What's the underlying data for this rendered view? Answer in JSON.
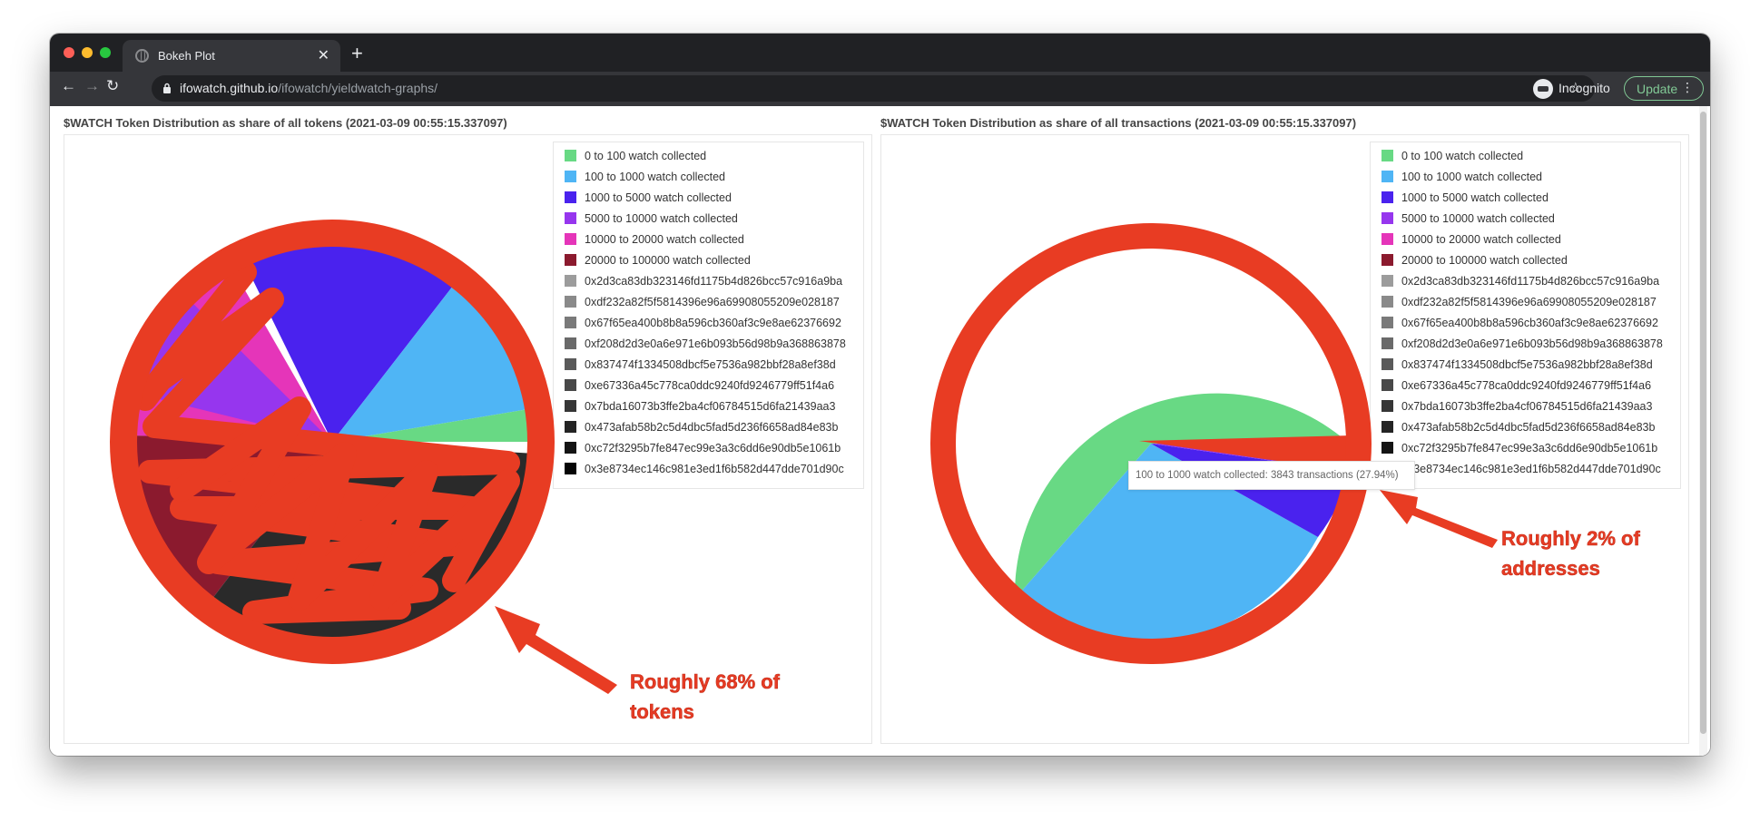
{
  "browser": {
    "tab_title": "Bokeh Plot",
    "url_host": "ifowatch.github.io",
    "url_path": "/ifowatch/yieldwatch-graphs/",
    "profile_label": "Incognito",
    "update_label": "Update"
  },
  "icons": [
    "close-icon",
    "plus-icon",
    "back-icon",
    "forward-icon",
    "reload-icon",
    "lock-icon",
    "star-icon",
    "incognito-icon",
    "more-icon"
  ],
  "plots": [
    {
      "title": "$WATCH Token Distribution as share of all tokens (2021-03-09 00:55:15.337097)"
    },
    {
      "title": "$WATCH Token Distribution as share of all transactions (2021-03-09 00:55:15.337097)"
    }
  ],
  "legend": [
    {
      "label": "0 to 100 watch collected",
      "color": "#68d984"
    },
    {
      "label": "100 to 1000 watch collected",
      "color": "#4fb5f5"
    },
    {
      "label": "1000 to 5000 watch collected",
      "color": "#4a22ee"
    },
    {
      "label": "5000 to 10000 watch collected",
      "color": "#9636ee"
    },
    {
      "label": "10000 to 20000 watch collected",
      "color": "#e535b9"
    },
    {
      "label": "20000 to 100000 watch collected",
      "color": "#8b1a2e"
    },
    {
      "label": "0x2d3ca83db323146fd1175b4d826bcc57c916a9ba",
      "color": "#9c9c9c"
    },
    {
      "label": "0xdf232a82f5f5814396e96a69908055209e028187",
      "color": "#8a8a8a"
    },
    {
      "label": "0x67f65ea400b8b8a596cb360af3c9e8ae62376692",
      "color": "#7a7a7a"
    },
    {
      "label": "0xf208d2d3e0a6e971e6b093b56d98b9a368863878",
      "color": "#6a6a6a"
    },
    {
      "label": "0x837474f1334508dbcf5e7536a982bbf28a8ef38d",
      "color": "#5a5a5a"
    },
    {
      "label": "0xe67336a45c778ca0ddc9240fd9246779ff51f4a6",
      "color": "#484848"
    },
    {
      "label": "0x7bda16073b3ffe2ba4cf06784515d6fa21439aa3",
      "color": "#363636"
    },
    {
      "label": "0x473afab58b2c5d4dbc5fad5d236f6658ad84e83b",
      "color": "#242424"
    },
    {
      "label": "0xc72f3295b7fe847ec99e3a3c6dd6e90db5e1061b",
      "color": "#141414"
    },
    {
      "label": "0x3e8734ec146c981e3ed1f6b582d447dde701d90c",
      "color": "#050505"
    }
  ],
  "tooltip": {
    "text": "100 to 1000 watch collected: 3843 transactions (27.94%)"
  },
  "annotations": {
    "left_line1": "Roughly 68% of",
    "left_line2": "tokens",
    "right_line1": "Roughly 2% of",
    "right_line2": "addresses"
  },
  "annotation_color": "#e63b24"
}
